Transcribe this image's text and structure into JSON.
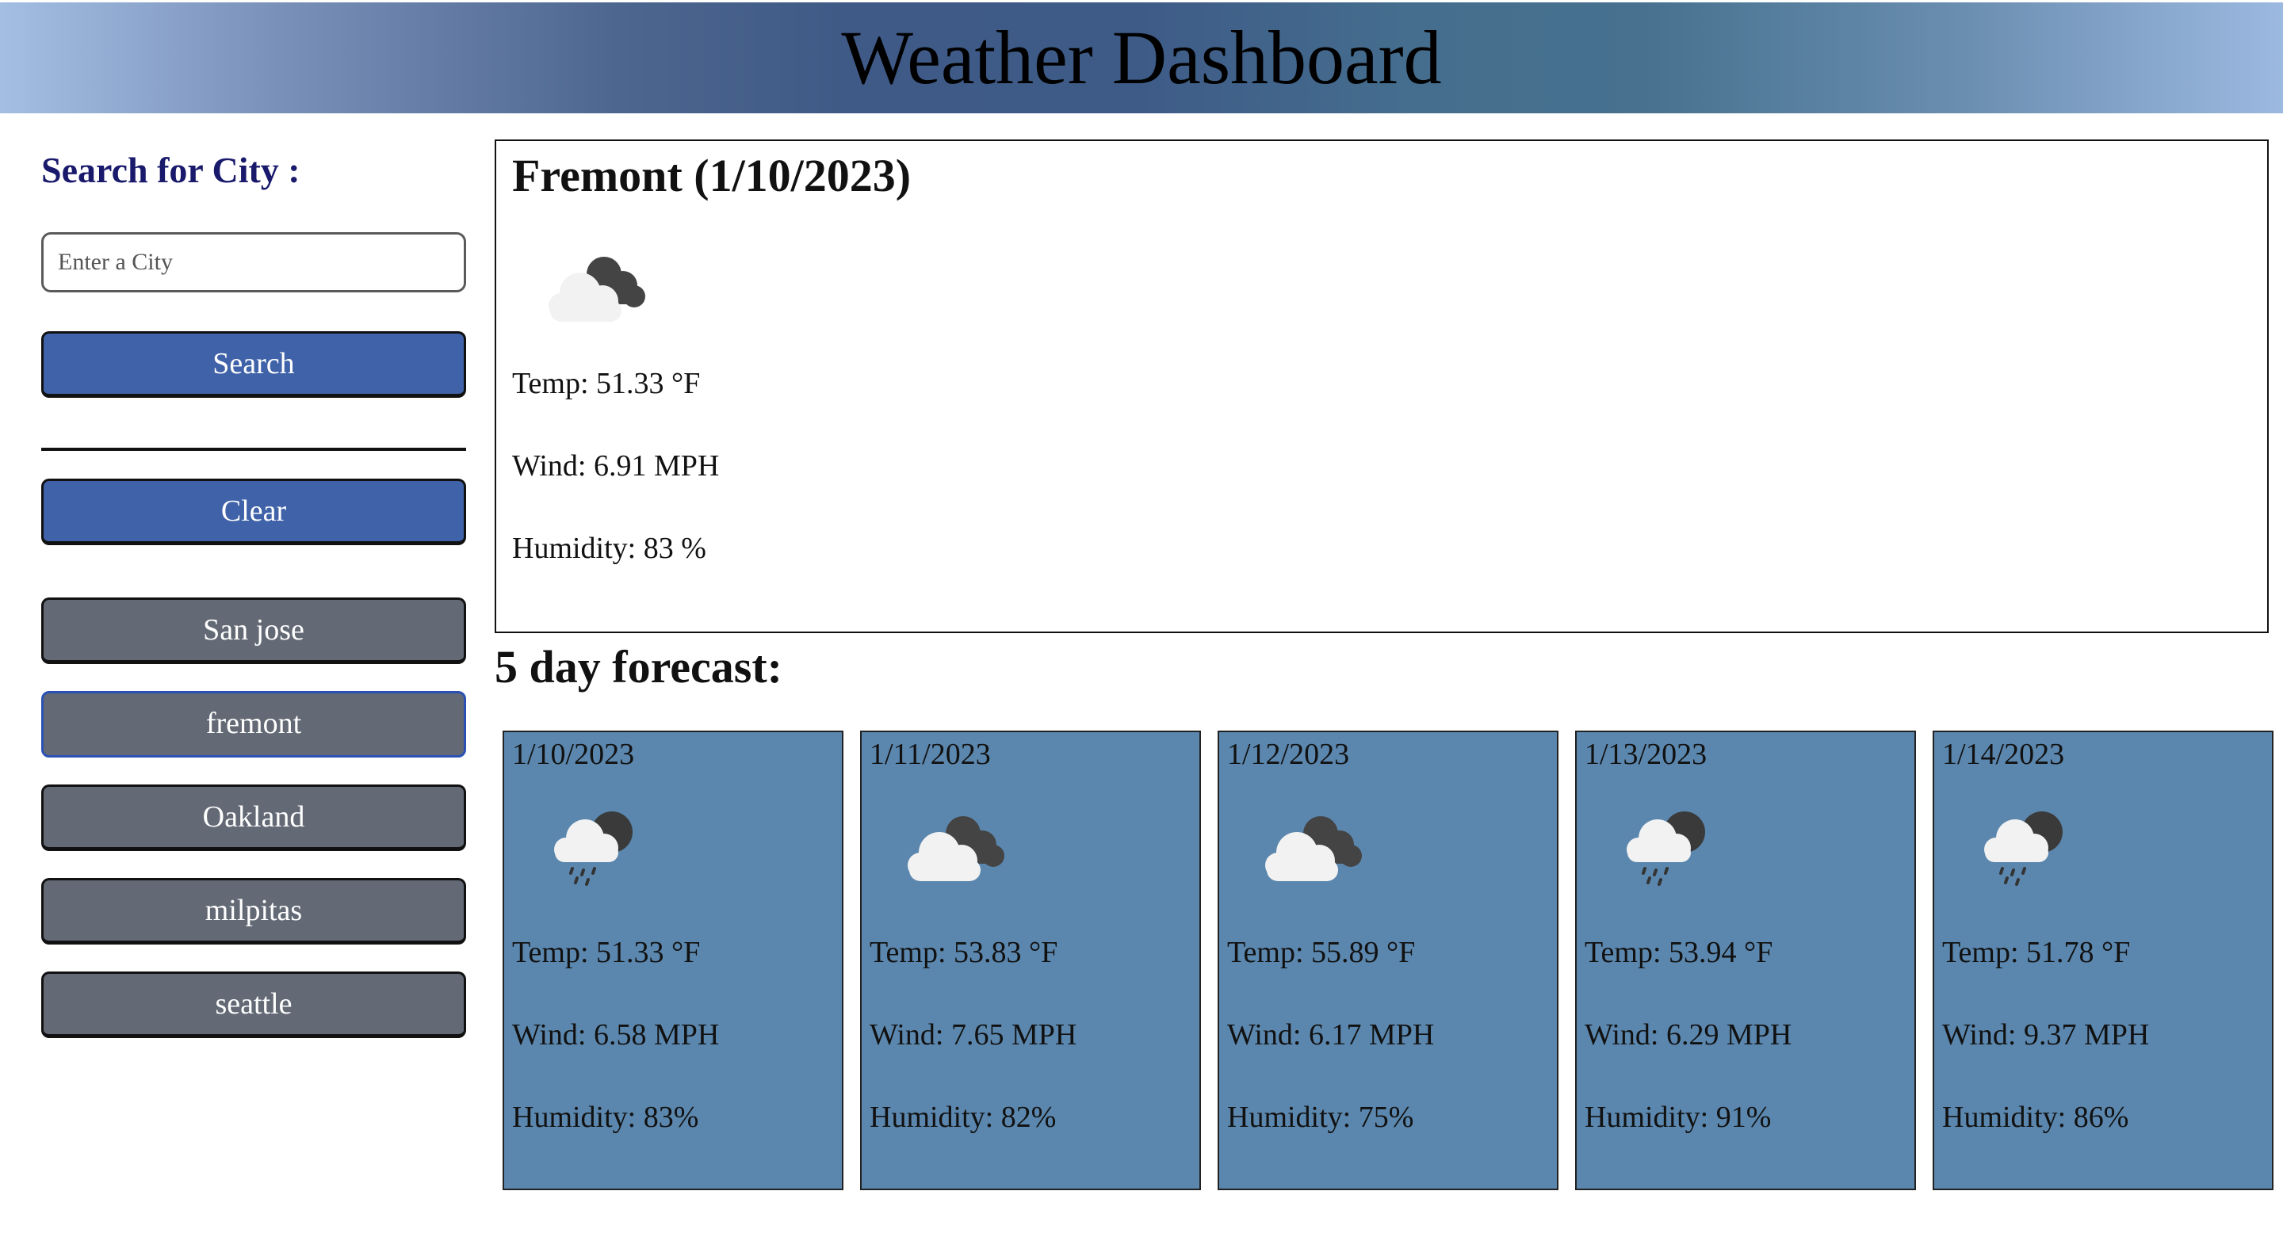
{
  "header": {
    "title": "Weather Dashboard"
  },
  "sidebar": {
    "search_label": "Search for City :",
    "search_placeholder": "Enter a City",
    "search_value": "",
    "search_button": "Search",
    "clear_button": "Clear",
    "history": [
      "San jose",
      "fremont",
      "Oakland",
      "milpitas",
      "seattle"
    ],
    "active_history": "fremont"
  },
  "current": {
    "title": "Fremont (1/10/2023)",
    "icon": "cloudy-icon",
    "temp": "Temp: 51.33 °F",
    "wind": "Wind: 6.91 MPH",
    "humidity": "Humidity: 83 %"
  },
  "forecast": {
    "heading": "5 day forecast:",
    "days": [
      {
        "date": "1/10/2023",
        "icon": "rain-icon",
        "temp": "Temp: 51.33 °F",
        "wind": "Wind: 6.58 MPH",
        "humidity": "Humidity: 83%"
      },
      {
        "date": "1/11/2023",
        "icon": "cloudy-icon",
        "temp": "Temp: 53.83 °F",
        "wind": "Wind: 7.65 MPH",
        "humidity": "Humidity: 82%"
      },
      {
        "date": "1/12/2023",
        "icon": "cloudy-icon",
        "temp": "Temp: 55.89 °F",
        "wind": "Wind: 6.17 MPH",
        "humidity": "Humidity: 75%"
      },
      {
        "date": "1/13/2023",
        "icon": "rain-icon",
        "temp": "Temp: 53.94 °F",
        "wind": "Wind: 6.29 MPH",
        "humidity": "Humidity: 91%"
      },
      {
        "date": "1/14/2023",
        "icon": "rain-icon",
        "temp": "Temp: 51.78 °F",
        "wind": "Wind: 9.37 MPH",
        "humidity": "Humidity: 86%"
      }
    ]
  },
  "colors": {
    "button_blue": "#3f62a8",
    "button_gray": "#636a75",
    "card_blue": "#5b87ae",
    "label_navy": "#1a1a6c"
  }
}
